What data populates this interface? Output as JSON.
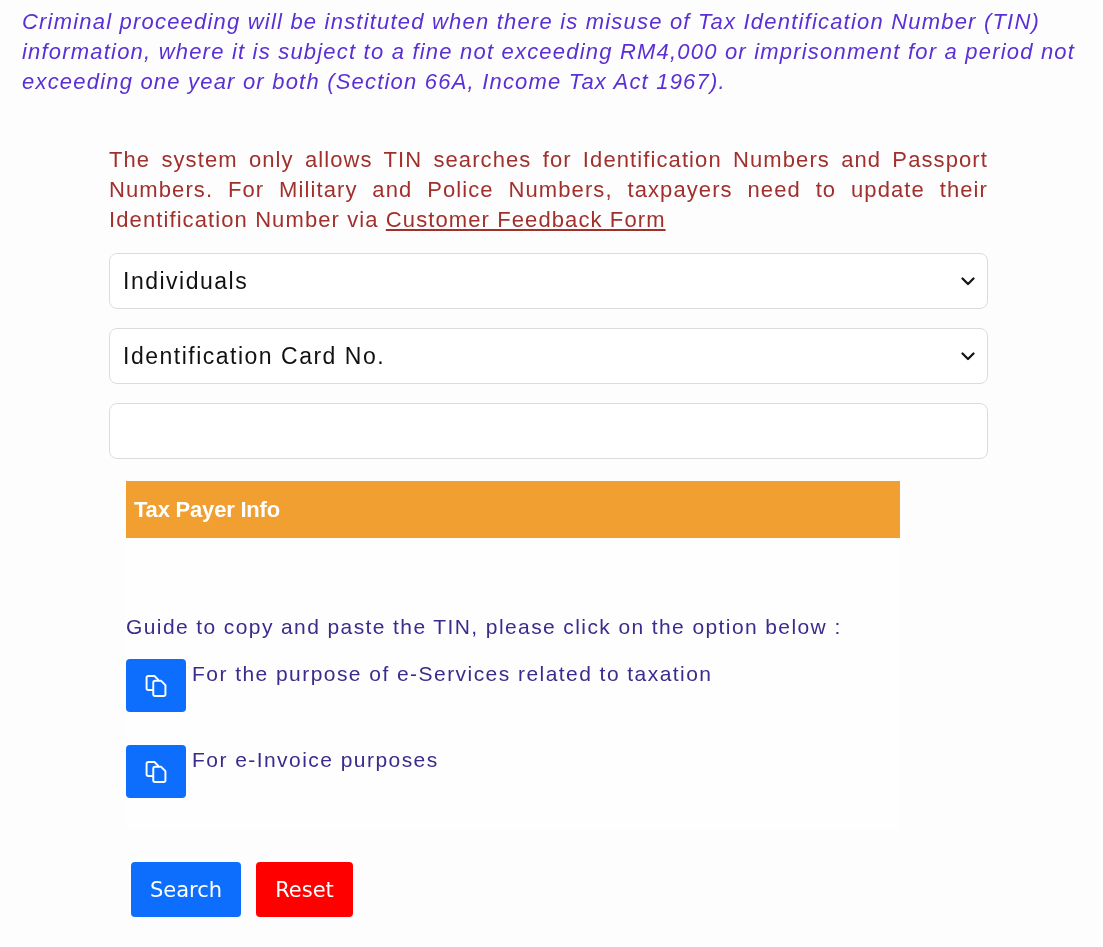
{
  "warning": {
    "text": "Criminal proceeding will be instituted when there is misuse of Tax Identification Number (TIN) information, where it is subject to a fine not exceeding RM4,000 or imprisonment for a period not exceeding one year or both (Section 66A, Income Tax Act 1967)."
  },
  "notice": {
    "text": "The system only allows TIN searches for Identification Numbers and Passport Numbers. For Military and Police Numbers, taxpayers need to update their Identification Number via",
    "link": "Customer Feedback Form"
  },
  "form": {
    "fields": [
      {
        "kind": "select",
        "value": "Individuals"
      },
      {
        "kind": "select",
        "value": "Identification Card No."
      },
      {
        "kind": "text"
      }
    ]
  },
  "info_panel": {
    "title": "Tax Payer Info",
    "guide": "Guide to copy and paste the TIN, please click on the option below :",
    "options": [
      {
        "label": "For the purpose of e-Services related to taxation"
      },
      {
        "label": "For e-Invoice purposes"
      }
    ]
  },
  "buttons": [
    {
      "kind": "primary",
      "label": "Search"
    },
    {
      "kind": "danger",
      "label": "Reset"
    }
  ]
}
